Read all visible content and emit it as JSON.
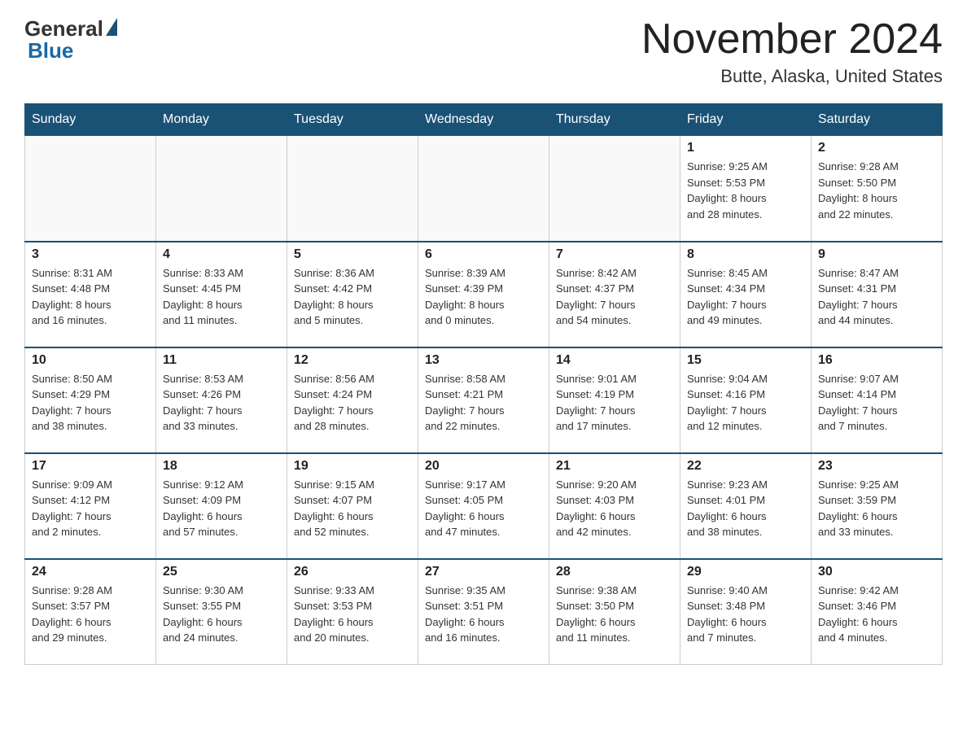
{
  "header": {
    "logo_general": "General",
    "logo_blue": "Blue",
    "title": "November 2024",
    "location": "Butte, Alaska, United States"
  },
  "weekdays": [
    "Sunday",
    "Monday",
    "Tuesday",
    "Wednesday",
    "Thursday",
    "Friday",
    "Saturday"
  ],
  "weeks": [
    [
      {
        "day": "",
        "info": ""
      },
      {
        "day": "",
        "info": ""
      },
      {
        "day": "",
        "info": ""
      },
      {
        "day": "",
        "info": ""
      },
      {
        "day": "",
        "info": ""
      },
      {
        "day": "1",
        "info": "Sunrise: 9:25 AM\nSunset: 5:53 PM\nDaylight: 8 hours\nand 28 minutes."
      },
      {
        "day": "2",
        "info": "Sunrise: 9:28 AM\nSunset: 5:50 PM\nDaylight: 8 hours\nand 22 minutes."
      }
    ],
    [
      {
        "day": "3",
        "info": "Sunrise: 8:31 AM\nSunset: 4:48 PM\nDaylight: 8 hours\nand 16 minutes."
      },
      {
        "day": "4",
        "info": "Sunrise: 8:33 AM\nSunset: 4:45 PM\nDaylight: 8 hours\nand 11 minutes."
      },
      {
        "day": "5",
        "info": "Sunrise: 8:36 AM\nSunset: 4:42 PM\nDaylight: 8 hours\nand 5 minutes."
      },
      {
        "day": "6",
        "info": "Sunrise: 8:39 AM\nSunset: 4:39 PM\nDaylight: 8 hours\nand 0 minutes."
      },
      {
        "day": "7",
        "info": "Sunrise: 8:42 AM\nSunset: 4:37 PM\nDaylight: 7 hours\nand 54 minutes."
      },
      {
        "day": "8",
        "info": "Sunrise: 8:45 AM\nSunset: 4:34 PM\nDaylight: 7 hours\nand 49 minutes."
      },
      {
        "day": "9",
        "info": "Sunrise: 8:47 AM\nSunset: 4:31 PM\nDaylight: 7 hours\nand 44 minutes."
      }
    ],
    [
      {
        "day": "10",
        "info": "Sunrise: 8:50 AM\nSunset: 4:29 PM\nDaylight: 7 hours\nand 38 minutes."
      },
      {
        "day": "11",
        "info": "Sunrise: 8:53 AM\nSunset: 4:26 PM\nDaylight: 7 hours\nand 33 minutes."
      },
      {
        "day": "12",
        "info": "Sunrise: 8:56 AM\nSunset: 4:24 PM\nDaylight: 7 hours\nand 28 minutes."
      },
      {
        "day": "13",
        "info": "Sunrise: 8:58 AM\nSunset: 4:21 PM\nDaylight: 7 hours\nand 22 minutes."
      },
      {
        "day": "14",
        "info": "Sunrise: 9:01 AM\nSunset: 4:19 PM\nDaylight: 7 hours\nand 17 minutes."
      },
      {
        "day": "15",
        "info": "Sunrise: 9:04 AM\nSunset: 4:16 PM\nDaylight: 7 hours\nand 12 minutes."
      },
      {
        "day": "16",
        "info": "Sunrise: 9:07 AM\nSunset: 4:14 PM\nDaylight: 7 hours\nand 7 minutes."
      }
    ],
    [
      {
        "day": "17",
        "info": "Sunrise: 9:09 AM\nSunset: 4:12 PM\nDaylight: 7 hours\nand 2 minutes."
      },
      {
        "day": "18",
        "info": "Sunrise: 9:12 AM\nSunset: 4:09 PM\nDaylight: 6 hours\nand 57 minutes."
      },
      {
        "day": "19",
        "info": "Sunrise: 9:15 AM\nSunset: 4:07 PM\nDaylight: 6 hours\nand 52 minutes."
      },
      {
        "day": "20",
        "info": "Sunrise: 9:17 AM\nSunset: 4:05 PM\nDaylight: 6 hours\nand 47 minutes."
      },
      {
        "day": "21",
        "info": "Sunrise: 9:20 AM\nSunset: 4:03 PM\nDaylight: 6 hours\nand 42 minutes."
      },
      {
        "day": "22",
        "info": "Sunrise: 9:23 AM\nSunset: 4:01 PM\nDaylight: 6 hours\nand 38 minutes."
      },
      {
        "day": "23",
        "info": "Sunrise: 9:25 AM\nSunset: 3:59 PM\nDaylight: 6 hours\nand 33 minutes."
      }
    ],
    [
      {
        "day": "24",
        "info": "Sunrise: 9:28 AM\nSunset: 3:57 PM\nDaylight: 6 hours\nand 29 minutes."
      },
      {
        "day": "25",
        "info": "Sunrise: 9:30 AM\nSunset: 3:55 PM\nDaylight: 6 hours\nand 24 minutes."
      },
      {
        "day": "26",
        "info": "Sunrise: 9:33 AM\nSunset: 3:53 PM\nDaylight: 6 hours\nand 20 minutes."
      },
      {
        "day": "27",
        "info": "Sunrise: 9:35 AM\nSunset: 3:51 PM\nDaylight: 6 hours\nand 16 minutes."
      },
      {
        "day": "28",
        "info": "Sunrise: 9:38 AM\nSunset: 3:50 PM\nDaylight: 6 hours\nand 11 minutes."
      },
      {
        "day": "29",
        "info": "Sunrise: 9:40 AM\nSunset: 3:48 PM\nDaylight: 6 hours\nand 7 minutes."
      },
      {
        "day": "30",
        "info": "Sunrise: 9:42 AM\nSunset: 3:46 PM\nDaylight: 6 hours\nand 4 minutes."
      }
    ]
  ]
}
